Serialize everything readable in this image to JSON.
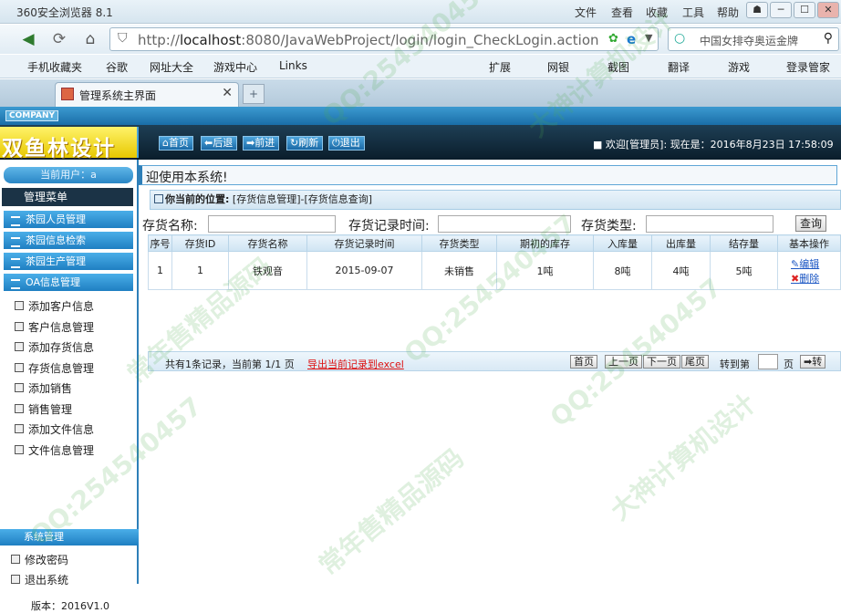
{
  "browser": {
    "title": "360安全浏览器 8.1",
    "menus": [
      "文件",
      "查看",
      "收藏",
      "工具",
      "帮助"
    ],
    "url_prefix": "http://",
    "url_host": "localhost",
    "url_rest": ":8080/JavaWebProject/login/login_CheckLogin.action",
    "search_text": "中国女排夺奥运金牌",
    "bookmarks": [
      "手机收藏夹",
      "谷歌",
      "网址大全",
      "游戏中心",
      "Links"
    ],
    "tools": [
      "扩展",
      "网银",
      "截图",
      "翻译",
      "游戏",
      "登录管家"
    ],
    "tab_title": "管理系统主界面"
  },
  "app": {
    "company": "COMPANY",
    "logo": "双鱼林设计",
    "header_buttons": [
      "首页",
      "后退",
      "前进",
      "刷新",
      "退出"
    ],
    "welcome": "■ 欢迎[管理员]: ",
    "datetime": "现在是：2016年8月23日 17:58:09",
    "current_user": "当前用户：a",
    "main_menu": "管理菜单",
    "groups": [
      "茶园人员管理",
      "茶园信息检索",
      "茶园生产管理",
      "OA信息管理"
    ],
    "oa_items": [
      "添加客户信息",
      "客户信息管理",
      "添加存货信息",
      "存货信息管理",
      "添加销售",
      "销售管理",
      "添加文件信息",
      "文件信息管理"
    ],
    "system_group": "系统管理",
    "system_items": [
      "修改密码",
      "退出系统"
    ],
    "version": "版本：2016V1.0"
  },
  "main": {
    "welcome_text": "迎使用本系统!",
    "location_label": "你当前的位置:",
    "location_path": "[存货信息管理]-[存货信息查询]",
    "filters": {
      "name_label": "存货名称:",
      "time_label": "存货记录时间:",
      "type_label": "存货类型:",
      "query_button": "查询"
    },
    "table": {
      "headers": [
        "序号",
        "存货ID",
        "存货名称",
        "存货记录时间",
        "存货类型",
        "期初的库存",
        "入库量",
        "出库量",
        "结存量",
        "基本操作"
      ],
      "rows": [
        [
          "1",
          "1",
          "铁观音",
          "2015-09-07",
          "未销售",
          "1吨",
          "8吨",
          "4吨",
          "5吨"
        ]
      ],
      "edit_label": "编辑",
      "delete_label": "删除"
    },
    "pager": {
      "info": "共有1条记录，当前第 1/1 页",
      "export": "导出当前记录到excel",
      "buttons": [
        "首页",
        "上一页",
        "下一页",
        "尾页"
      ],
      "goto_label": "转到第",
      "page_label": "页",
      "go_button": "➡转"
    }
  },
  "watermarks": [
    "QQ:254540457",
    "大神计算机设计",
    "常年售精品源码",
    "QQ:254540457",
    "大神计算机设计",
    "常年售精品源码",
    "QQ:254540457",
    "QQ:254540457"
  ]
}
